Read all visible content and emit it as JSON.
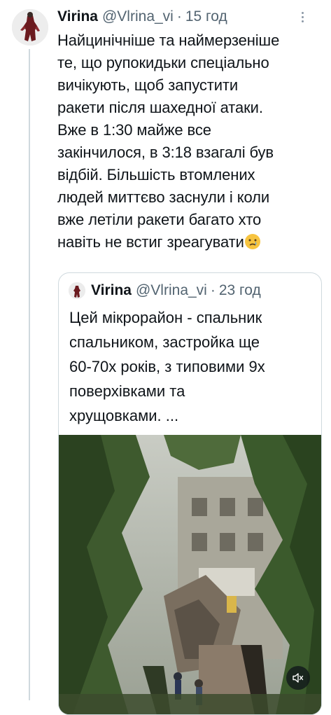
{
  "tweet": {
    "author_name": "Virina",
    "handle": "@Vlrina_vi",
    "separator": "·",
    "time": "15 год",
    "text_lines": [
      "Найцинічніше та наймерзеніше",
      "те, що рупокидьки спеціально",
      "вичікують,  щоб запустити",
      "ракети після шахедної атаки.",
      "Вже в 1:30 майже все",
      "закінчилося, в 3:18 взагалі був",
      "відбій. Більшість втомлених",
      "людей миттєво заснули і коли",
      "вже летіли ракети багато хто",
      "навіть не встиг зреагувати"
    ],
    "emoji": "😢"
  },
  "quote": {
    "author_name": "Virina",
    "handle": "@Vlrina_vi",
    "separator": "·",
    "time": "23 год",
    "text_lines": [
      "Цей мікрорайон - спальник",
      "спальником, застройка ще",
      "60-70х років, з типовими 9х",
      "поверхівками та",
      "хрущовками. ..."
    ]
  },
  "colors": {
    "text": "#0f1419",
    "secondary": "#536471",
    "border": "#cfd9de"
  },
  "icons": {
    "more": "more-dots-icon",
    "mute": "speaker-muted-icon"
  }
}
